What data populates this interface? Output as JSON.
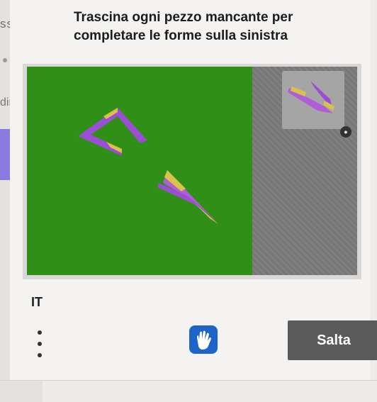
{
  "background": {
    "partial_text": "ssw",
    "partial_label": "dim"
  },
  "captcha": {
    "instruction": "Trascina ogni pezzo mancante per completare le forme sulla sinistra",
    "language": "IT",
    "skip_label": "Salta",
    "menu_icon": "vertical-dots-icon",
    "brand_icon": "hand-logo-icon",
    "lock_icon": "lock-icon",
    "colors": {
      "board_green": "#2f8f16",
      "tray_gray": "#7b7a7b",
      "piece_purple": "#9b4dd6",
      "piece_yellow": "#d8c24a",
      "skip_bg": "#5a5a5a",
      "brand_blue": "#1e63c9"
    }
  }
}
